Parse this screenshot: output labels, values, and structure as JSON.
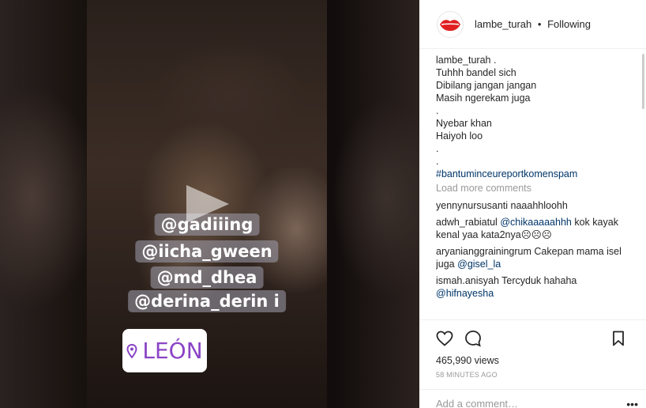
{
  "video": {
    "captions": [
      "@gadiiing",
      "@iicha_gween",
      "@md_dhea",
      "@derina_derin i"
    ],
    "location": "LEÓN"
  },
  "header": {
    "username": "lambe_turah",
    "separator": "•",
    "follow_label": "Following"
  },
  "caption": {
    "username": "lambe_turah",
    "lines": [
      ".",
      "Tuhhh bandel sich",
      "Dibilang jangan jangan",
      "Masih ngerekam juga",
      ".",
      "Nyebar khan",
      "Haiyoh loo",
      ".",
      "."
    ],
    "hashtag": "#bantuminceureportkomenspam"
  },
  "load_more": "Load more comments",
  "comments": [
    {
      "user": "yennynursusanti",
      "text": "naaahhloohh"
    },
    {
      "user": "adwh_rabiatul",
      "mention": "@chikaaaaahhh",
      "text": "kok kayak kenal yaa kata2nya☹☹☹"
    },
    {
      "user": "aryanianggrainingrum",
      "text": "Cakepan mama isel juga",
      "mention": "@gisel_la"
    },
    {
      "user": "ismah.anisyah",
      "text": "Tercyduk hahaha",
      "mention": "@hifnayesha"
    }
  ],
  "stats": {
    "views": "465,990 views",
    "time": "58 MINUTES AGO"
  },
  "add_comment_placeholder": "Add a comment…",
  "icons": [
    "heart-icon",
    "comment-icon",
    "bookmark-icon",
    "play-icon",
    "location-pin-icon",
    "more-options-icon"
  ],
  "colors": {
    "hashtag": "#003569",
    "location": "#8b44c6",
    "muted": "#999999"
  }
}
